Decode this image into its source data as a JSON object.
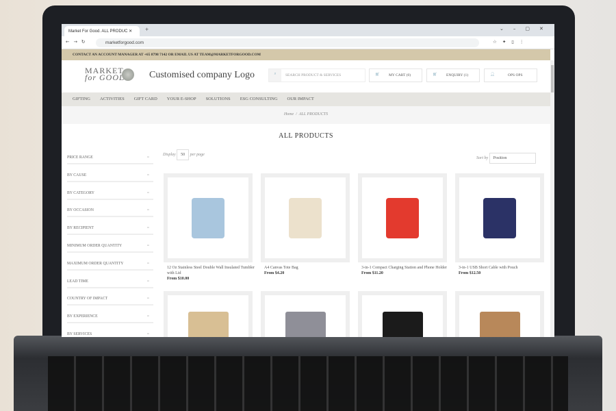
{
  "browser": {
    "tab_title": "Market For Good. ALL PRODUC",
    "url": "marketforgood.com"
  },
  "contact_bar": "CONTACT AN ACCOUNT MANAGER AT +65 8798 7142 OR EMAIL US AT TEAM@MARKETFORGOOD.COM",
  "header": {
    "logo_line1": "MARKET",
    "logo_line2": "for GOOD",
    "company_logo": "Customised company Logo",
    "search_placeholder": "SEARCH PRODUCT & SERVICES",
    "cart": "MY CART (0)",
    "enquiry": "ENQUIRY (1)",
    "user": "OPS OPS"
  },
  "nav": [
    "GIFTING",
    "ACTIVITIES",
    "GIFT CARD",
    "YOUR E-SHOP",
    "SOLUTIONS",
    "ESG CONSULTING",
    "OUR IMPACT"
  ],
  "breadcrumb": {
    "home": "Home",
    "sep": "/",
    "current": "ALL PRODUCTS"
  },
  "page_title": "ALL PRODUCTS",
  "filters": [
    "PRICE RANGE",
    "BY CAUSE",
    "BY CATEGORY",
    "BY OCCASION",
    "BY RECIPIENT",
    "MINIMUM ORDER QUANTITY",
    "MAXIMUM ORDER QUANTITY",
    "LEAD TIME",
    "COUNTRY OF IMPACT",
    "BY EXPERIENCE",
    "BY SERVICES"
  ],
  "toolbar": {
    "display_label": "Display",
    "display_value": "50",
    "per_page": "per page",
    "sort_label": "Sort by",
    "sort_value": "Position"
  },
  "products": [
    {
      "name": "12 Oz Stainless Steel Double Wall Insulated Tumbler with Lid",
      "price": "From $10.00"
    },
    {
      "name": "A4 Canvas Tote Bag",
      "price": "From $4.20"
    },
    {
      "name": "3-in-1 Compact Charging Station and Phone Holder",
      "price": "From $11.20"
    },
    {
      "name": "3-in-1 USB Short Cable with Pouch",
      "price": "From $12.50"
    }
  ],
  "colors": {
    "contact_bar": "#d4c8aa",
    "nav_bg": "#e6e5e1",
    "accent": "#8fb4c4"
  }
}
